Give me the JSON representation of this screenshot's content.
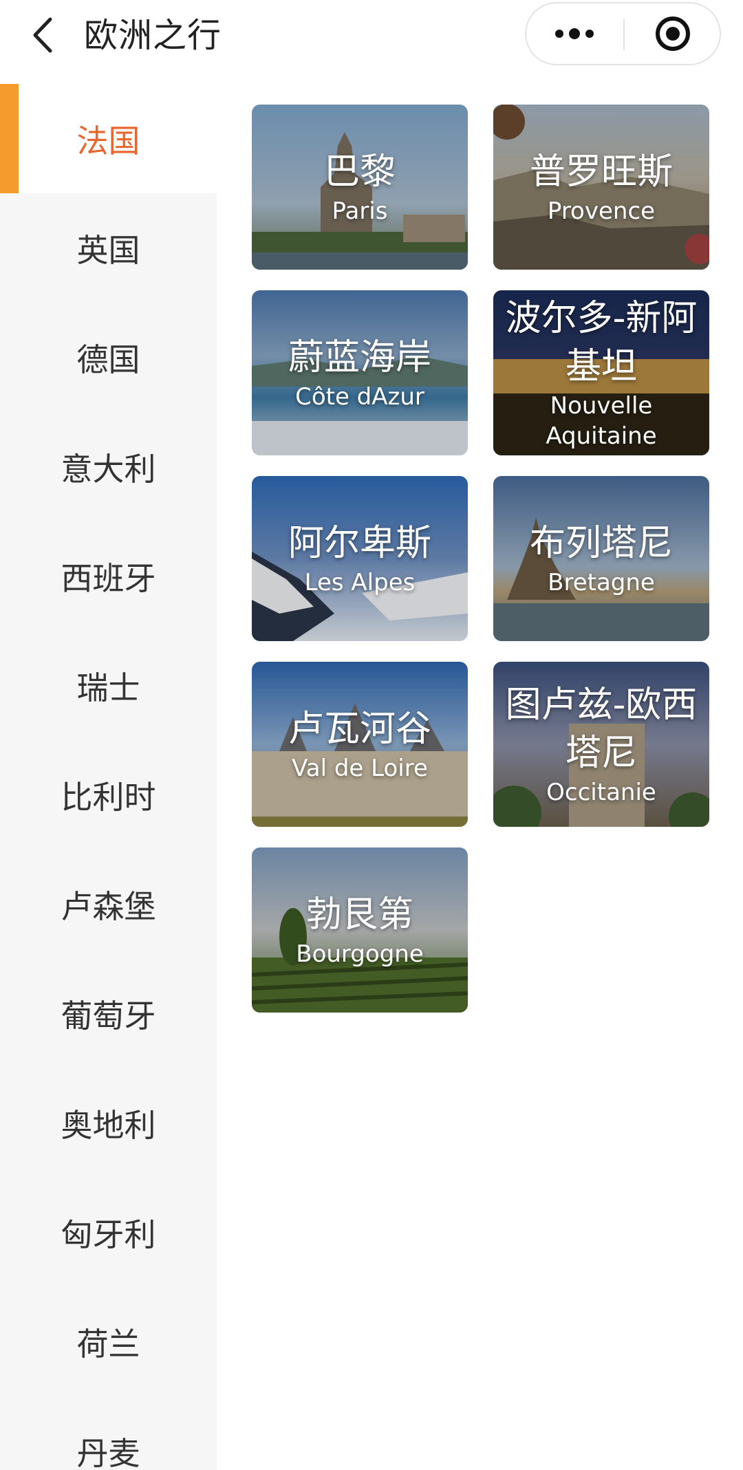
{
  "header": {
    "title": "欧洲之行",
    "back_icon": "chevron-left-icon",
    "more_icon": "more-dots-icon",
    "close_icon": "target-circle-icon"
  },
  "sidebar": {
    "items": [
      {
        "label": "法国",
        "active": true
      },
      {
        "label": "英国"
      },
      {
        "label": "德国"
      },
      {
        "label": "意大利"
      },
      {
        "label": "西班牙"
      },
      {
        "label": "瑞士"
      },
      {
        "label": "比利时"
      },
      {
        "label": "卢森堡"
      },
      {
        "label": "葡萄牙"
      },
      {
        "label": "奥地利"
      },
      {
        "label": "匈牙利"
      },
      {
        "label": "荷兰"
      },
      {
        "label": "丹麦"
      }
    ],
    "active_color": "#e8672f",
    "indicator_color": "#f59a2c"
  },
  "regions": [
    {
      "cn": "巴黎",
      "en": "Paris"
    },
    {
      "cn": "普罗旺斯",
      "en": "Provence"
    },
    {
      "cn": "蔚蓝海岸",
      "en": "Côte dAzur"
    },
    {
      "cn": "波尔多-新阿基坦",
      "en": "Nouvelle Aquitaine"
    },
    {
      "cn": "阿尔卑斯",
      "en": "Les Alpes"
    },
    {
      "cn": "布列塔尼",
      "en": "Bretagne"
    },
    {
      "cn": "卢瓦河谷",
      "en": "Val de Loire"
    },
    {
      "cn": "图卢兹-欧西塔尼",
      "en": "Occitanie"
    },
    {
      "cn": "勃艮第",
      "en": "Bourgogne"
    }
  ]
}
